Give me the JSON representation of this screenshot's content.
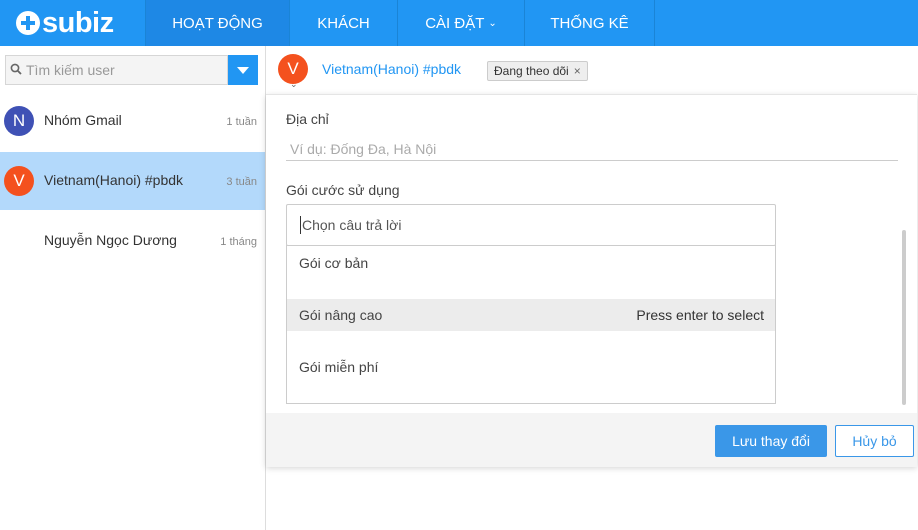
{
  "app": {
    "logo_text": "subiz"
  },
  "nav": {
    "tabs": [
      {
        "label": "HOẠT ĐỘNG",
        "active": true
      },
      {
        "label": "KHÁCH",
        "active": false
      },
      {
        "label": "CÀI ĐẶT",
        "active": false,
        "caret": "⌄"
      },
      {
        "label": "THỐNG KÊ",
        "active": false
      }
    ]
  },
  "search": {
    "placeholder": "Tìm kiếm user"
  },
  "conversations": [
    {
      "initial": "N",
      "name": "Nhóm Gmail",
      "time": "1 tuần",
      "avatar_color": "#3f51b5",
      "selected": false
    },
    {
      "initial": "V",
      "name": "Vietnam(Hanoi) #pbdk",
      "time": "3 tuần",
      "avatar_color": "#f4511e",
      "selected": true
    },
    {
      "initial": "",
      "name": "Nguyễn Ngọc Dương",
      "time": "1 tháng",
      "avatar_color": "",
      "selected": false
    }
  ],
  "header": {
    "initial": "V",
    "avatar_color": "#f4511e",
    "name": "Vietnam(Hanoi) #pbdk",
    "follow_tag": "Đang theo dõi",
    "follow_close": "×"
  },
  "form": {
    "address_label": "Địa chỉ",
    "address_placeholder": "Ví dụ: Đống Đa, Hà Nội",
    "plan_label": "Gói cước sử dụng",
    "plan_placeholder": "Chọn câu trả lời",
    "options": [
      {
        "label": "Gói cơ bản",
        "highlight": false
      },
      {
        "label": "Gói nâng cao",
        "highlight": true,
        "hint": "Press enter to select"
      },
      {
        "label": "Gói miễn phí",
        "highlight": false
      }
    ],
    "save_label": "Lưu thay đổi",
    "cancel_label": "Hủy bỏ"
  },
  "colors": {
    "brand": "#2196f3",
    "selected_row": "#b3d9fb"
  }
}
